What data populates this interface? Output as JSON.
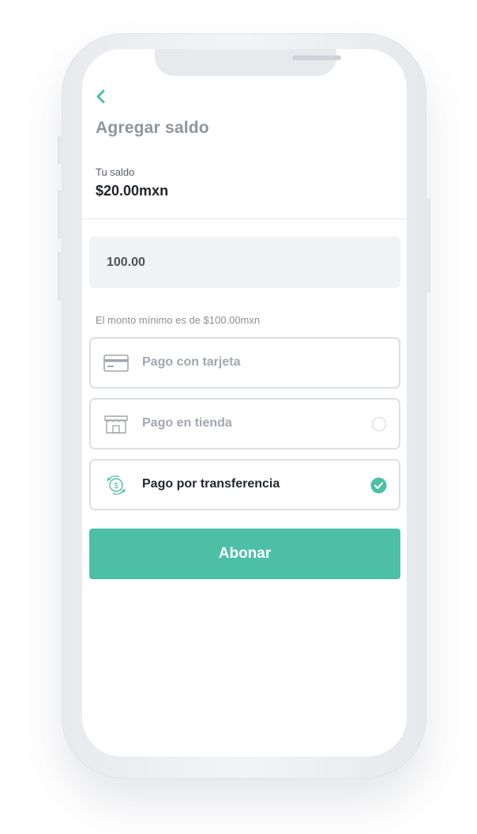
{
  "header": {
    "back_icon": "chevron-left-icon",
    "title": "Agregar saldo"
  },
  "balance": {
    "label": "Tu saldo",
    "value": "$20.00mxn"
  },
  "amount_input": {
    "value": "100.00"
  },
  "hint": "El monto mínimo es de $100.00mxn",
  "payment_options": [
    {
      "label": "Pago con tarjeta",
      "icon": "credit-card-icon",
      "selected": false
    },
    {
      "label": "Pago en tienda",
      "icon": "store-icon",
      "selected": false
    },
    {
      "label": "Pago por transferencia",
      "icon": "transfer-icon",
      "selected": true
    }
  ],
  "submit": {
    "label": "Abonar"
  },
  "colors": {
    "accent": "#4dbfa6",
    "title": "#8f959c",
    "text_dark": "#1f2328",
    "muted": "#a2a7ad",
    "input_bg": "#f1f2f4",
    "border": "#dcdfe3"
  }
}
